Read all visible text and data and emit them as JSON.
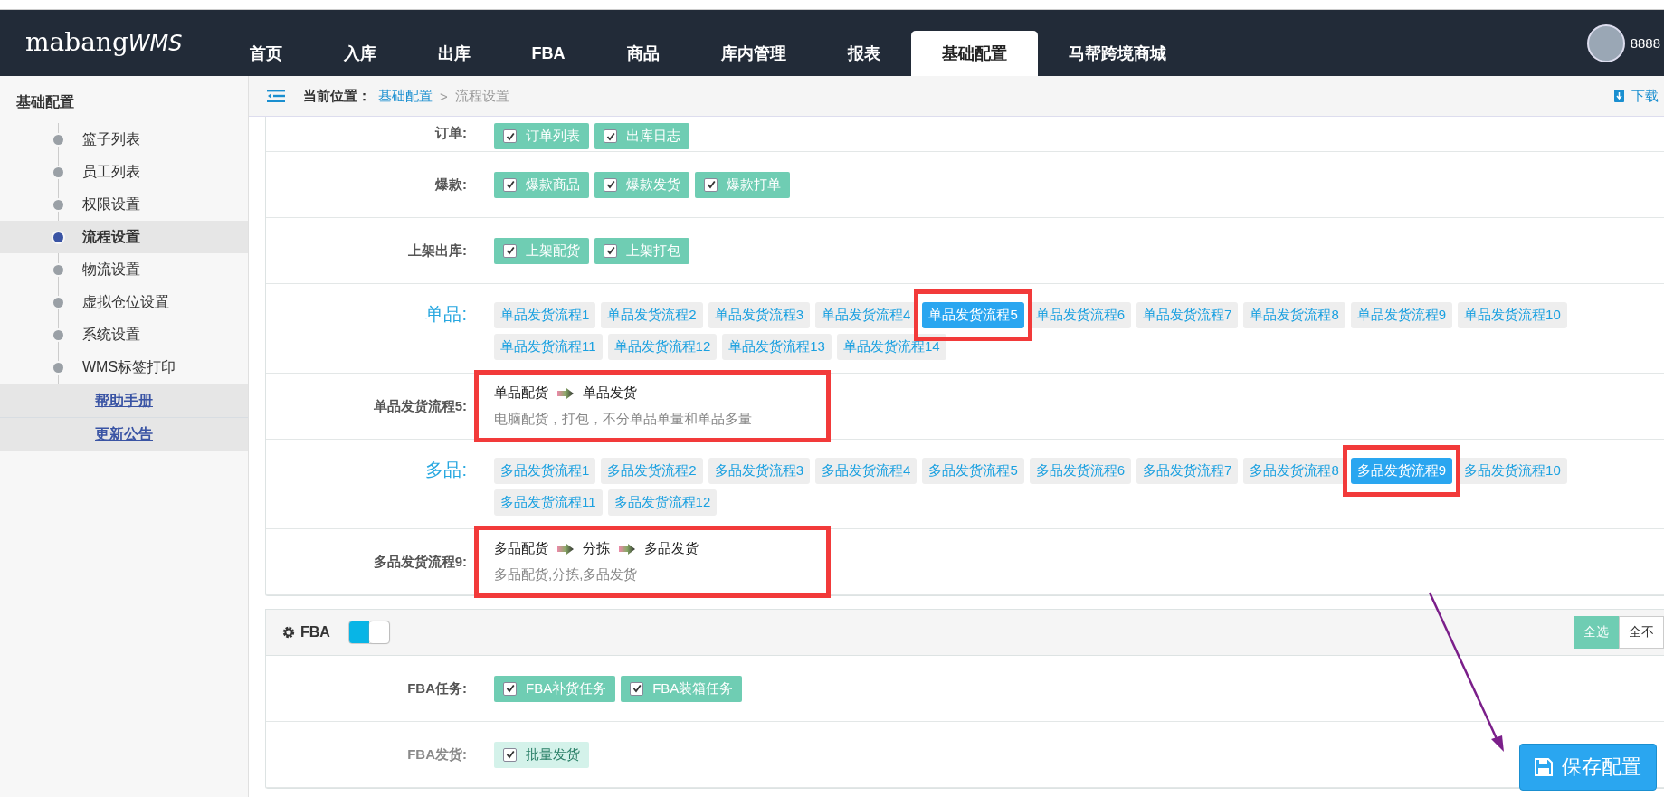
{
  "header": {
    "logo": {
      "brand": "mabang",
      "suffix": "WMS"
    },
    "nav": [
      {
        "label": "首页",
        "selected": false
      },
      {
        "label": "入库",
        "selected": false
      },
      {
        "label": "出库",
        "selected": false
      },
      {
        "label": "FBA",
        "selected": false
      },
      {
        "label": "商品",
        "selected": false
      },
      {
        "label": "库内管理",
        "selected": false
      },
      {
        "label": "报表",
        "selected": false
      },
      {
        "label": "基础配置",
        "selected": true
      },
      {
        "label": "马帮跨境商城",
        "selected": false
      }
    ],
    "user": "8888"
  },
  "sidebar": {
    "title": "基础配置",
    "items": [
      {
        "label": "篮子列表",
        "selected": false
      },
      {
        "label": "员工列表",
        "selected": false
      },
      {
        "label": "权限设置",
        "selected": false
      },
      {
        "label": "流程设置",
        "selected": true
      },
      {
        "label": "物流设置",
        "selected": false
      },
      {
        "label": "虚拟仓位设置",
        "selected": false
      },
      {
        "label": "系统设置",
        "selected": false
      },
      {
        "label": "WMS标签打印",
        "selected": false
      }
    ],
    "links": [
      "帮助手册",
      "更新公告"
    ]
  },
  "breadcrumb": {
    "label": "当前位置：",
    "path": [
      "基础配置",
      "流程设置"
    ],
    "separator": ">",
    "download": "下载"
  },
  "rows": [
    {
      "kind": "checks",
      "label": "订单:",
      "options": [
        {
          "label": "订单列表",
          "checked": true
        },
        {
          "label": "出库日志",
          "checked": true
        }
      ]
    },
    {
      "kind": "checks",
      "label": "爆款:",
      "options": [
        {
          "label": "爆款商品",
          "checked": true
        },
        {
          "label": "爆款发货",
          "checked": true
        },
        {
          "label": "爆款打单",
          "checked": true
        }
      ]
    },
    {
      "kind": "checks",
      "label": "上架出库:",
      "options": [
        {
          "label": "上架配货",
          "checked": true
        },
        {
          "label": "上架打包",
          "checked": true
        }
      ]
    },
    {
      "kind": "picker",
      "label": "单品:",
      "options": [
        {
          "label": "单品发货流程1",
          "selected": false
        },
        {
          "label": "单品发货流程2",
          "selected": false
        },
        {
          "label": "单品发货流程3",
          "selected": false
        },
        {
          "label": "单品发货流程4",
          "selected": false
        },
        {
          "label": "单品发货流程5",
          "selected": true
        },
        {
          "label": "单品发货流程6",
          "selected": false
        },
        {
          "label": "单品发货流程7",
          "selected": false
        },
        {
          "label": "单品发货流程8",
          "selected": false
        },
        {
          "label": "单品发货流程9",
          "selected": false
        },
        {
          "label": "单品发货流程10",
          "selected": false
        },
        {
          "label": "单品发货流程11",
          "selected": false
        },
        {
          "label": "单品发货流程12",
          "selected": false
        },
        {
          "label": "单品发货流程13",
          "selected": false
        },
        {
          "label": "单品发货流程14",
          "selected": false
        }
      ]
    },
    {
      "kind": "detail",
      "label": "单品发货流程5:",
      "steps": [
        "单品配货",
        "单品发货"
      ],
      "description": "电脑配货，打包，不分单品单量和单品多量"
    },
    {
      "kind": "picker",
      "label": "多品:",
      "options": [
        {
          "label": "多品发货流程1",
          "selected": false
        },
        {
          "label": "多品发货流程2",
          "selected": false
        },
        {
          "label": "多品发货流程3",
          "selected": false
        },
        {
          "label": "多品发货流程4",
          "selected": false
        },
        {
          "label": "多品发货流程5",
          "selected": false
        },
        {
          "label": "多品发货流程6",
          "selected": false
        },
        {
          "label": "多品发货流程7",
          "selected": false
        },
        {
          "label": "多品发货流程8",
          "selected": false
        },
        {
          "label": "多品发货流程9",
          "selected": true
        },
        {
          "label": "多品发货流程10",
          "selected": false
        },
        {
          "label": "多品发货流程11",
          "selected": false
        },
        {
          "label": "多品发货流程12",
          "selected": false
        }
      ]
    },
    {
      "kind": "detail",
      "label": "多品发货流程9:",
      "steps": [
        "多品配货",
        "分拣",
        "多品发货"
      ],
      "description": "多品配货,分拣,多品发货"
    }
  ],
  "fba": {
    "title": "FBA",
    "enabled": true,
    "buttons": [
      {
        "label": "全选",
        "selected": true
      },
      {
        "label": "全不",
        "selected": false
      }
    ],
    "rows": [
      {
        "kind": "checks",
        "label": "FBA任务:",
        "options": [
          {
            "label": "FBA补货任务",
            "checked": true
          },
          {
            "label": "FBA装箱任务",
            "checked": true
          }
        ]
      },
      {
        "kind": "checks",
        "label": "FBA发货:",
        "options": [
          {
            "label": "批量发货",
            "checked": true
          }
        ]
      }
    ]
  },
  "save_button": "保存配置"
}
